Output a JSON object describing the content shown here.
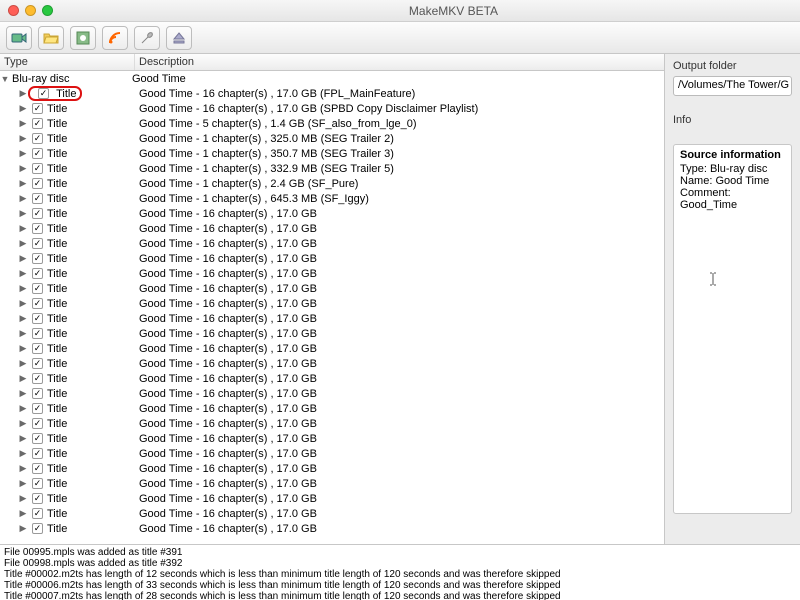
{
  "window": {
    "title": "MakeMKV BETA"
  },
  "columns": {
    "type": "Type",
    "description": "Description"
  },
  "root": {
    "type": "Blu-ray disc",
    "description": "Good Time"
  },
  "titleLabel": "Title",
  "children": [
    {
      "desc": "Good Time - 16 chapter(s) , 17.0 GB (FPL_MainFeature)",
      "hl": true
    },
    {
      "desc": "Good Time - 16 chapter(s) , 17.0 GB (SPBD Copy Disclaimer Playlist)"
    },
    {
      "desc": "Good Time - 5 chapter(s) , 1.4 GB (SF_also_from_lge_0)"
    },
    {
      "desc": "Good Time - 1 chapter(s) , 325.0 MB (SEG Trailer 2)"
    },
    {
      "desc": "Good Time - 1 chapter(s) , 350.7 MB (SEG Trailer 3)"
    },
    {
      "desc": "Good Time - 1 chapter(s) , 332.9 MB (SEG Trailer 5)"
    },
    {
      "desc": "Good Time - 1 chapter(s) , 2.4 GB (SF_Pure)"
    },
    {
      "desc": "Good Time - 1 chapter(s) , 645.3 MB (SF_Iggy)"
    },
    {
      "desc": "Good Time - 16 chapter(s) , 17.0 GB"
    },
    {
      "desc": "Good Time - 16 chapter(s) , 17.0 GB"
    },
    {
      "desc": "Good Time - 16 chapter(s) , 17.0 GB"
    },
    {
      "desc": "Good Time - 16 chapter(s) , 17.0 GB"
    },
    {
      "desc": "Good Time - 16 chapter(s) , 17.0 GB"
    },
    {
      "desc": "Good Time - 16 chapter(s) , 17.0 GB"
    },
    {
      "desc": "Good Time - 16 chapter(s) , 17.0 GB"
    },
    {
      "desc": "Good Time - 16 chapter(s) , 17.0 GB"
    },
    {
      "desc": "Good Time - 16 chapter(s) , 17.0 GB"
    },
    {
      "desc": "Good Time - 16 chapter(s) , 17.0 GB"
    },
    {
      "desc": "Good Time - 16 chapter(s) , 17.0 GB"
    },
    {
      "desc": "Good Time - 16 chapter(s) , 17.0 GB"
    },
    {
      "desc": "Good Time - 16 chapter(s) , 17.0 GB"
    },
    {
      "desc": "Good Time - 16 chapter(s) , 17.0 GB"
    },
    {
      "desc": "Good Time - 16 chapter(s) , 17.0 GB"
    },
    {
      "desc": "Good Time - 16 chapter(s) , 17.0 GB"
    },
    {
      "desc": "Good Time - 16 chapter(s) , 17.0 GB"
    },
    {
      "desc": "Good Time - 16 chapter(s) , 17.0 GB"
    },
    {
      "desc": "Good Time - 16 chapter(s) , 17.0 GB"
    },
    {
      "desc": "Good Time - 16 chapter(s) , 17.0 GB"
    },
    {
      "desc": "Good Time - 16 chapter(s) , 17.0 GB"
    },
    {
      "desc": "Good Time - 16 chapter(s) , 17.0 GB"
    }
  ],
  "right": {
    "outputLabel": "Output folder",
    "outputPath": "/Volumes/The Tower/G",
    "infoLabel": "Info",
    "info": {
      "hdr": "Source information",
      "typeLabel": "Type: ",
      "typeVal": "Blu-ray disc",
      "nameLabel": "Name: ",
      "nameVal": "Good Time",
      "commentLabel": "Comment: ",
      "commentVal": "Good_Time"
    }
  },
  "log": [
    "File 00995.mpls was added as title #391",
    "File 00998.mpls was added as title #392",
    "Title #00002.m2ts has length of 12 seconds which is less than minimum title length of 120 seconds and was therefore skipped",
    "Title #00006.m2ts has length of 33 seconds which is less than minimum title length of 120 seconds and was therefore skipped",
    "Title #00007.m2ts has length of 28 seconds which is less than minimum title length of 120 seconds and was therefore skipped"
  ]
}
